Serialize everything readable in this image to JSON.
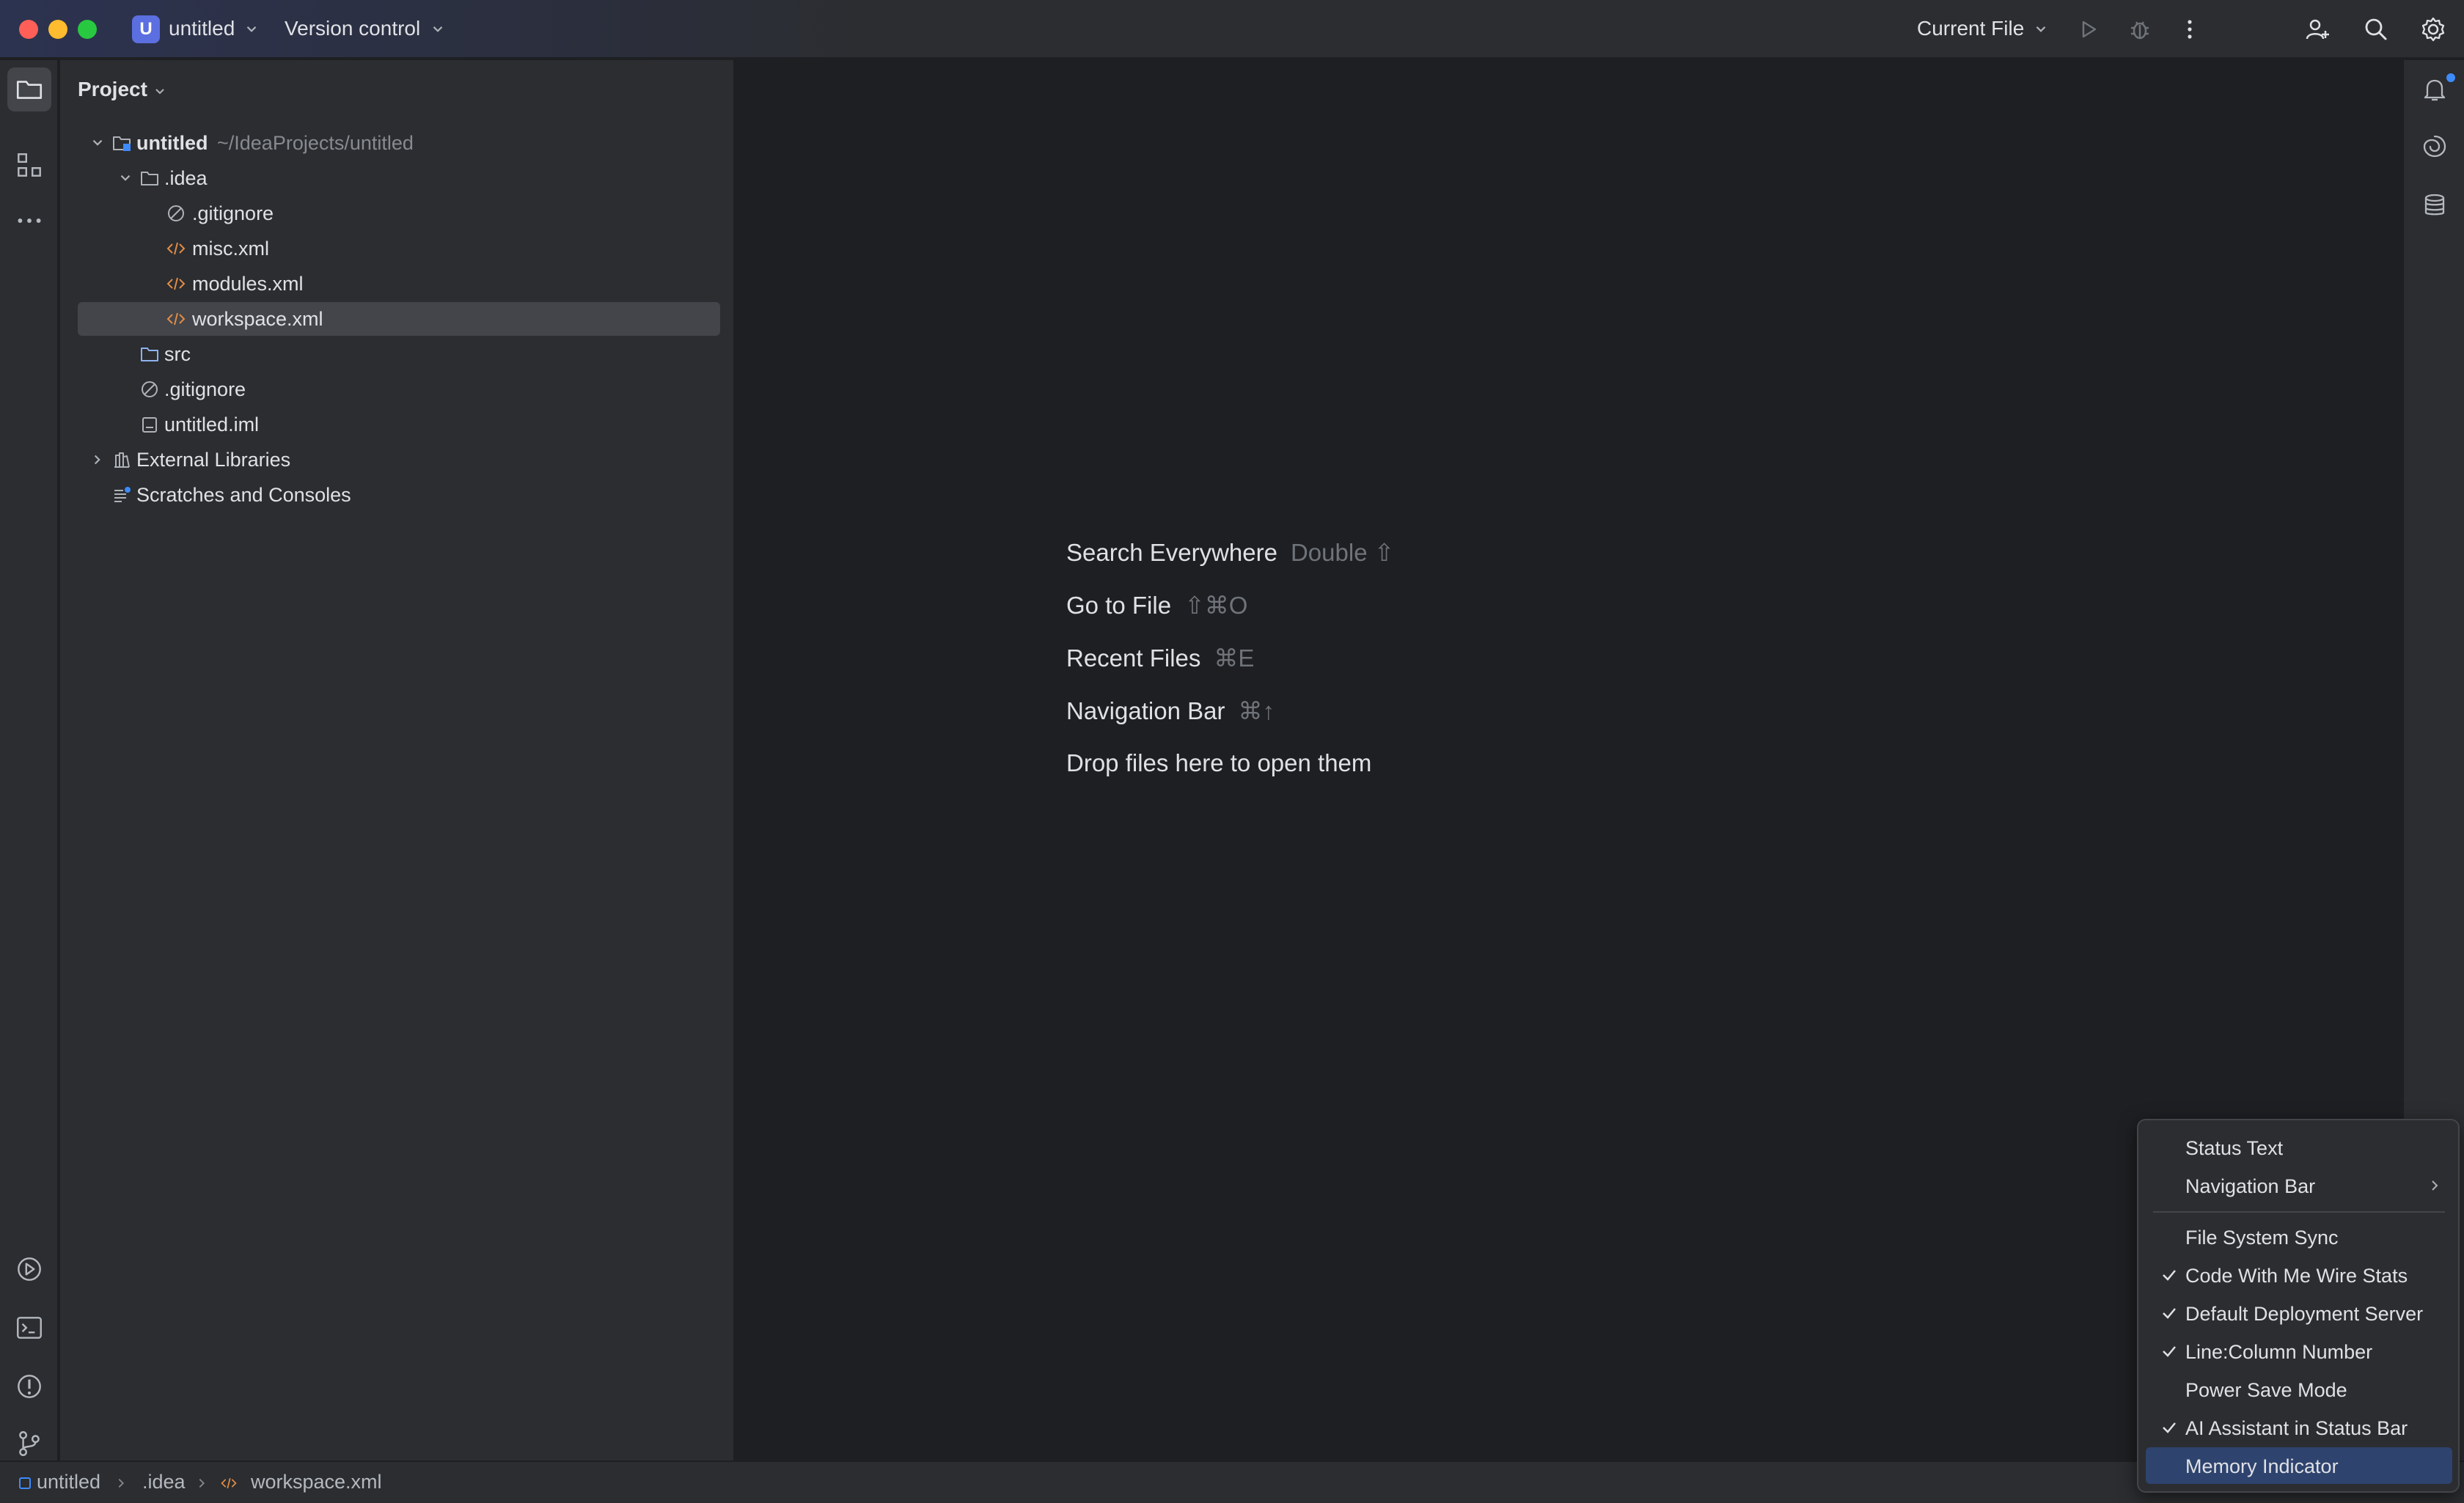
{
  "window": {
    "project_badge": "U",
    "project_name": "untitled",
    "vcs_label": "Version control",
    "run_config": "Current File"
  },
  "project_panel": {
    "header": "Project",
    "tree": [
      {
        "label": "untitled",
        "path": "~/IdeaProjects/untitled",
        "icon": "module-folder-icon"
      },
      {
        "label": ".idea",
        "icon": "folder-icon"
      },
      {
        "label": ".gitignore",
        "icon": "ignored-file-icon"
      },
      {
        "label": "misc.xml",
        "icon": "xml-file-icon"
      },
      {
        "label": "modules.xml",
        "icon": "xml-file-icon"
      },
      {
        "label": "workspace.xml",
        "icon": "xml-file-icon",
        "selected": true
      },
      {
        "label": "src",
        "icon": "source-folder-icon"
      },
      {
        "label": ".gitignore",
        "icon": "ignored-file-icon"
      },
      {
        "label": "untitled.iml",
        "icon": "iml-file-icon"
      },
      {
        "label": "External Libraries",
        "icon": "library-icon"
      },
      {
        "label": "Scratches and Consoles",
        "icon": "scratches-icon"
      }
    ]
  },
  "editor_hints": [
    {
      "label": "Search Everywhere",
      "shortcut": "Double ⇧"
    },
    {
      "label": "Go to File",
      "shortcut": "⇧⌘O"
    },
    {
      "label": "Recent Files",
      "shortcut": "⌘E"
    },
    {
      "label": "Navigation Bar",
      "shortcut": "⌘↑"
    },
    {
      "label": "Drop files here to open them",
      "shortcut": ""
    }
  ],
  "status_bar": {
    "breadcrumbs": [
      "untitled",
      ".idea",
      "workspace.xml"
    ]
  },
  "context_menu": {
    "items": [
      {
        "label": "Status Text",
        "checked": false
      },
      {
        "label": "Navigation Bar",
        "checked": false,
        "submenu": true
      },
      {
        "label": "File System Sync",
        "checked": false
      },
      {
        "label": "Code With Me Wire Stats",
        "checked": true
      },
      {
        "label": "Default Deployment Server",
        "checked": true
      },
      {
        "label": "Line:Column Number",
        "checked": true
      },
      {
        "label": "Power Save Mode",
        "checked": false
      },
      {
        "label": "AI Assistant in Status Bar",
        "checked": true
      },
      {
        "label": "Memory Indicator",
        "checked": false,
        "highlighted": true
      }
    ]
  },
  "colors": {
    "background": "#1e1f22",
    "panel": "#2b2d30",
    "selection": "#43454a",
    "menu_highlight": "#2e436e",
    "accent": "#5c6fe0",
    "xml_icon": "#e08c47",
    "folder_icon": "#8fb2f0"
  }
}
